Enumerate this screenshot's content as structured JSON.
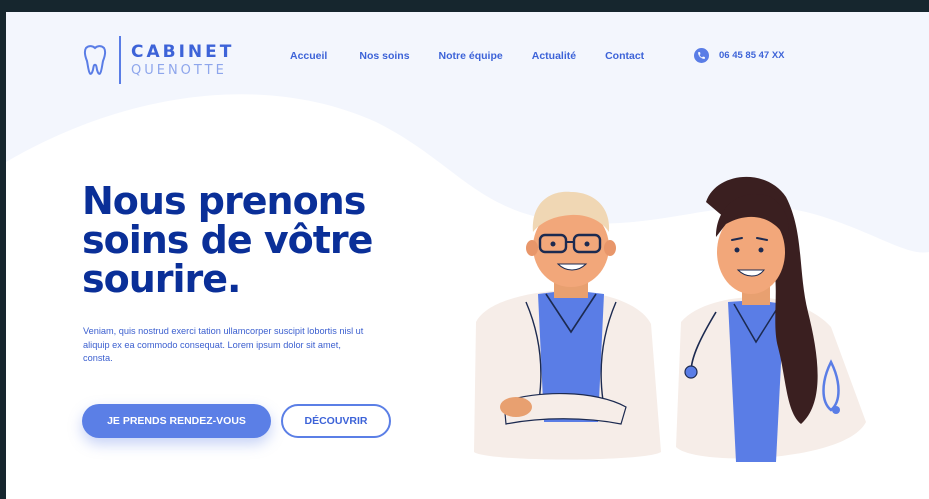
{
  "brand": {
    "title": "CABINET",
    "subtitle": "QUENOTTE",
    "icon": "tooth-icon",
    "accent": "#5a7de6",
    "primary_dark": "#0a2f98"
  },
  "nav": {
    "items": [
      {
        "label": "Accueil"
      },
      {
        "label": "Nos soins"
      },
      {
        "label": "Notre équipe"
      },
      {
        "label": "Actualité"
      },
      {
        "label": "Contact"
      }
    ]
  },
  "contact": {
    "phone": "06 45 85 47 XX",
    "icon": "phone-icon"
  },
  "hero": {
    "title_line1": "Nous prenons",
    "title_line2": "soins de vôtre",
    "title_line3": "sourire.",
    "text": "Veniam, quis nostrud exerci tation ullamcorper suscipit lobortis nisl ut aliquip ex ea commodo consequat. Lorem ipsum dolor sit amet, consta.",
    "primary_button": "JE PRENDS RENDEZ-VOUS",
    "secondary_button": "DÉCOUVRIR"
  }
}
